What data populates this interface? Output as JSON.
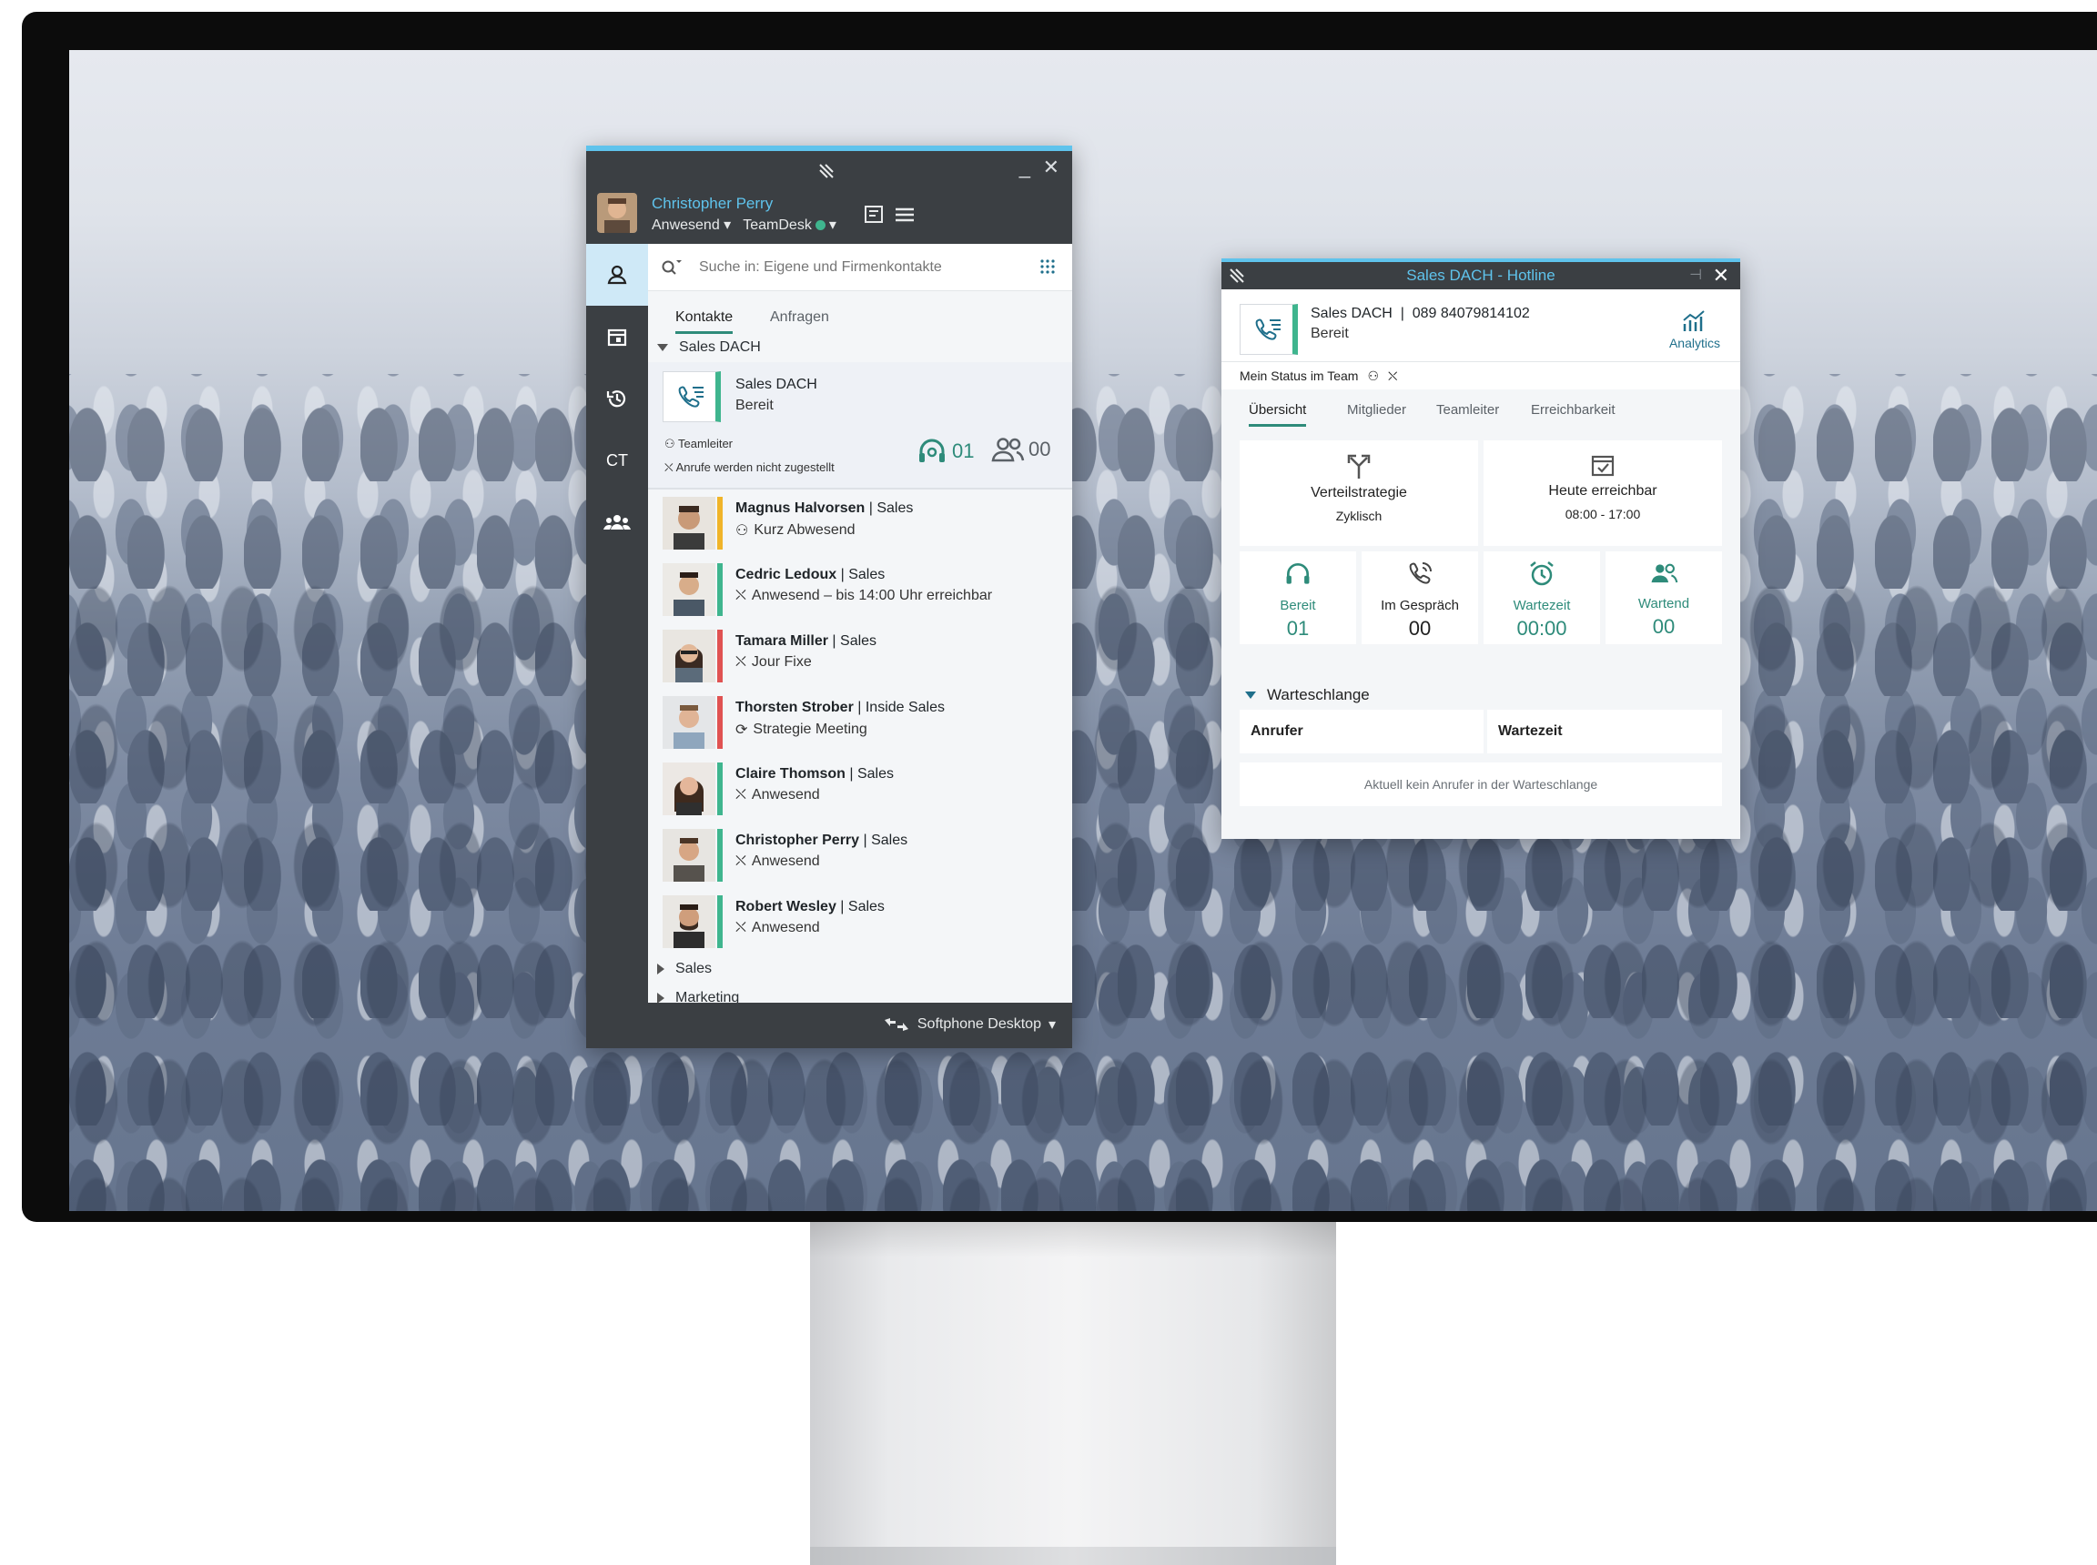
{
  "app": {
    "user_name": "Christopher Perry",
    "user_presence": "Anwesend",
    "user_context": "TeamDesk",
    "search_placeholder": "Suche in: Eigene und Firmenkontakte",
    "sidebar_ct": "CT",
    "tabs": [
      "Kontakte",
      "Anfragen"
    ],
    "group_open": "Sales DACH",
    "team": {
      "name": "Sales DACH",
      "status": "Bereit",
      "role": "Teamleiter",
      "note": "Anrufe werden nicht zugestellt",
      "ready_count": "01",
      "waiting_count": "00"
    },
    "contacts": [
      {
        "name": "Magnus Halvorsen",
        "dept": "Sales",
        "status": "Kurz Abwesend",
        "bar": "#f0b429"
      },
      {
        "name": "Cedric Ledoux",
        "dept": "Sales",
        "status": "Anwesend – bis 14:00 Uhr erreichbar",
        "bar": "#3fb58e"
      },
      {
        "name": "Tamara Miller",
        "dept": "Sales",
        "status": "Jour Fixe",
        "bar": "#e05252"
      },
      {
        "name": "Thorsten Strober",
        "dept": "Inside Sales",
        "status": "Strategie Meeting",
        "bar": "#e05252"
      },
      {
        "name": "Claire Thomson",
        "dept": "Sales",
        "status": "Anwesend",
        "bar": "#3fb58e"
      },
      {
        "name": "Christopher Perry",
        "dept": "Sales",
        "status": "Anwesend",
        "bar": "#3fb58e"
      },
      {
        "name": "Robert Wesley",
        "dept": "Sales",
        "status": "Anwesend",
        "bar": "#3fb58e"
      }
    ],
    "groups_closed": [
      "Sales",
      "Marketing"
    ],
    "footer_device": "Softphone Desktop"
  },
  "hotline": {
    "title": "Sales DACH - Hotline",
    "name": "Sales DACH",
    "number": "089 84079814102",
    "status": "Bereit",
    "analytics": "Analytics",
    "my_status_label": "Mein Status im Team",
    "tabs": [
      "Übersicht",
      "Mitglieder",
      "Teamleiter",
      "Erreichbarkeit"
    ],
    "strategy_label": "Verteilstrategie",
    "strategy_value": "Zyklisch",
    "reach_label": "Heute erreichbar",
    "reach_value": "08:00 - 17:00",
    "stats": [
      {
        "label": "Bereit",
        "value": "01",
        "color": "#2e8b7a"
      },
      {
        "label": "Im Gespräch",
        "value": "00",
        "color": "#222222"
      },
      {
        "label": "Wartezeit",
        "value": "00:00",
        "color": "#2e8b7a"
      },
      {
        "label": "Wartend",
        "value": "00",
        "color": "#2e8b7a"
      }
    ],
    "queue_title": "Warteschlange",
    "queue_cols": [
      "Anrufer",
      "Wartezeit"
    ],
    "queue_empty": "Aktuell kein Anrufer in der Warteschlange"
  }
}
